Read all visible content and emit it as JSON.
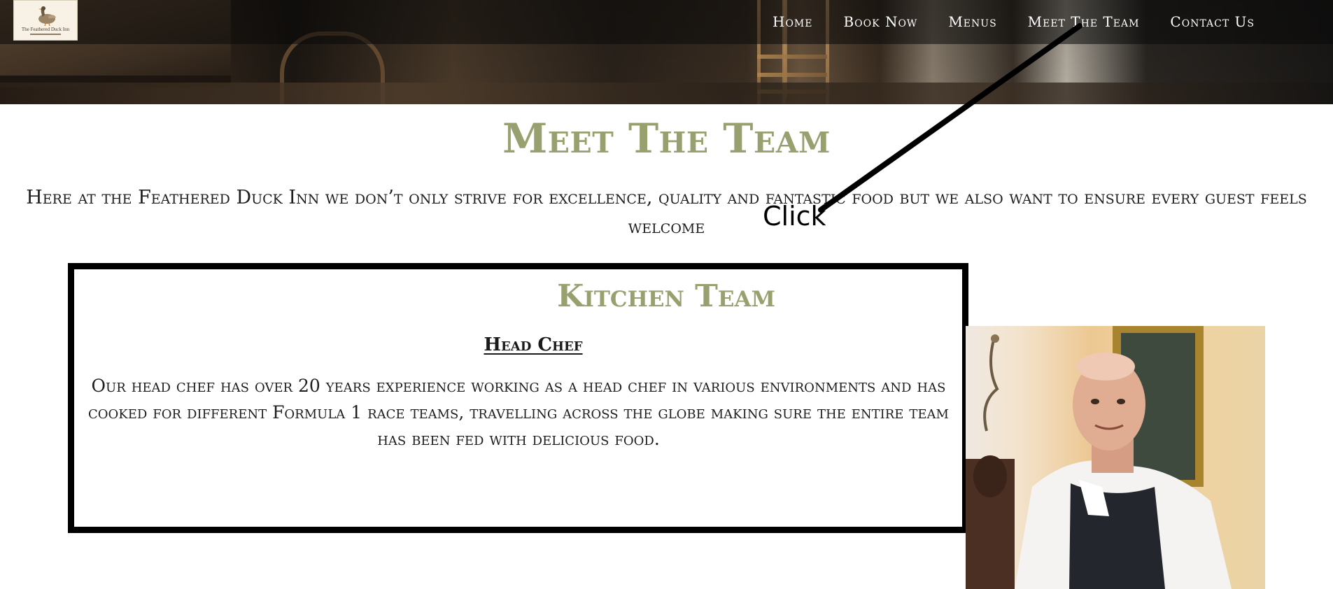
{
  "header": {
    "logo": {
      "name": "The Feathered Duck Inn",
      "icon": "duck-icon"
    },
    "nav": [
      {
        "label": "Home"
      },
      {
        "label": "Book Now"
      },
      {
        "label": "Menus"
      },
      {
        "label": "Meet The Team"
      },
      {
        "label": "Contact Us"
      }
    ]
  },
  "main": {
    "title": "Meet The Team",
    "intro": "Here at the Feathered Duck Inn we don’t only strive for excellence, quality and fantastic food but we also want to ensure every guest feels welcome",
    "section": {
      "title": "Kitchen Team",
      "role": "Head Chef",
      "description": "Our head chef has over 20 years experience working as a head chef in various environments and has cooked for different Formula 1 race teams, travelling across the globe making sure the entire team has been fed with delicious food."
    }
  },
  "annotation": {
    "label": "Click"
  },
  "colors": {
    "heading": "#98a06f",
    "nav_text": "#ffffff",
    "box_border": "#000000"
  }
}
